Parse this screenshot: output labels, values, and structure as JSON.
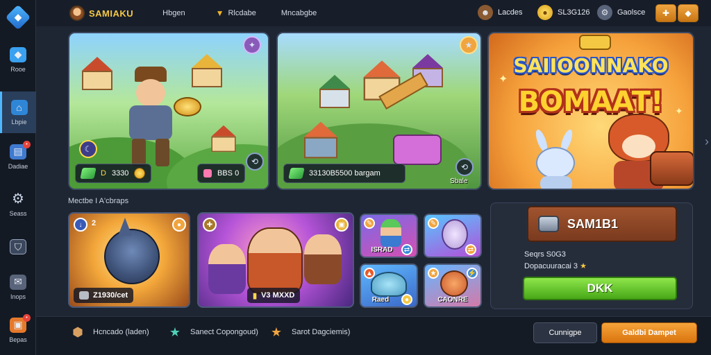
{
  "app": {
    "name": "SAMIAKU"
  },
  "nav": {
    "link1": "Hbgen",
    "link2": "Rlcdabe",
    "link3": "Mncabgbe"
  },
  "resources": [
    {
      "label": "Lacdes",
      "icon": "character-icon"
    },
    {
      "label": "SL3G126",
      "icon": "coin-icon"
    },
    {
      "label": "Gaolsce",
      "icon": "gear-icon"
    }
  ],
  "sidebar": {
    "items": [
      {
        "label": "Rooe",
        "icon": "tag-icon"
      },
      {
        "label": "Lbpie",
        "icon": "home-icon",
        "active": true
      },
      {
        "label": "Dadiae",
        "icon": "chat-icon"
      },
      {
        "label": "Seass",
        "icon": "gear-icon"
      },
      {
        "label": "",
        "icon": "shield-icon"
      },
      {
        "label": "Inops",
        "icon": "mail-icon"
      },
      {
        "label": "Bepas",
        "icon": "gift-icon"
      }
    ]
  },
  "heroes": [
    {
      "caption_value": "D",
      "caption_amount": "3330"
    },
    {
      "caption_text": "33130B5500 bargam",
      "corner_label": "Sbale"
    },
    {
      "title_line1": "SAIIOONNAKO",
      "title_line2": "BOMAAT!"
    }
  ],
  "hero1_chip": "BBS 0",
  "section_label": "Mectbe I A'cbraps",
  "tiles": [
    {
      "chip": "2",
      "label": "Z1930/cet"
    },
    {
      "label": "V3 MXXD"
    },
    {
      "label": "ISRAD"
    },
    {
      "label": ""
    },
    {
      "label": "Raed"
    },
    {
      "label": "CAONRE"
    }
  ],
  "panel": {
    "banner": "SAM1B1",
    "line1": "Seqrs S0G3",
    "line2": "Dopacuuracai 3",
    "button": "DKK"
  },
  "bottom": {
    "item1": "Hcncado (laden)",
    "item2": "Sanect Copongoud)",
    "item3": "Sarot Dagciemis)",
    "btn_secondary": "Cunnigpe",
    "btn_primary": "Galdbi Dampet"
  },
  "colors": {
    "accent": "#4fb7ff",
    "primary_button": "#d9740e",
    "ok_button": "#48a818",
    "badge": "#e8433a"
  }
}
